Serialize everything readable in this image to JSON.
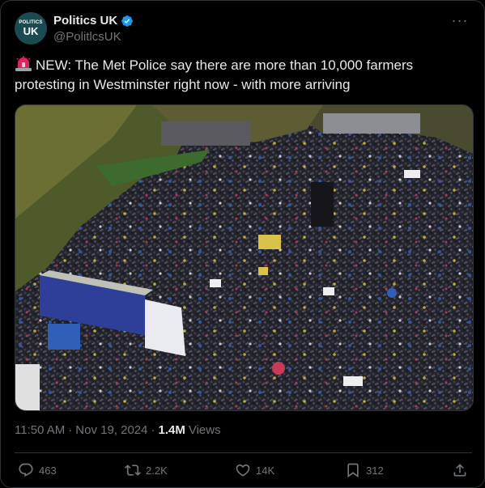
{
  "author": {
    "display_name": "Politics UK",
    "handle": "@PolitlcsUK",
    "avatar_text_small": "POLITICS",
    "avatar_text_big": "UK"
  },
  "tweet": {
    "text": "NEW: The Met Police say there are more than 10,000 farmers protesting in Westminster right now - with more arriving",
    "icon": "police-siren-emoji"
  },
  "meta": {
    "time": "11:50 AM",
    "sep1": "·",
    "date": "Nov 19, 2024",
    "sep2": "·",
    "views_count": "1.4M",
    "views_label": "Views"
  },
  "actions": {
    "replies": "463",
    "reposts": "2.2K",
    "likes": "14K",
    "bookmarks": "312"
  },
  "colors": {
    "background": "#000000",
    "text": "#e7e9ea",
    "secondary": "#71767b",
    "verified": "#1d9bf0",
    "border": "#2f3336"
  }
}
